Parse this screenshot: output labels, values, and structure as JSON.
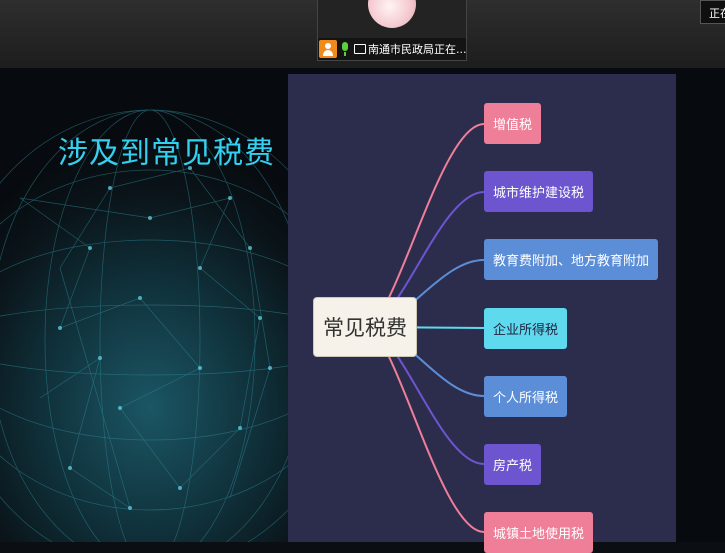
{
  "meeting": {
    "participant_name": "南通市民政局正在...",
    "status_text": "正在"
  },
  "slide": {
    "title": "涉及到常见税费",
    "mindmap": {
      "root": "常见税费",
      "branches": [
        {
          "label": "增值税",
          "color": "#ef7f99"
        },
        {
          "label": "城市维护建设税",
          "color": "#6c55cf"
        },
        {
          "label": "教育费附加、地方教育附加",
          "color": "#5c8ed8"
        },
        {
          "label": "企业所得税",
          "color": "#5fd9ee"
        },
        {
          "label": "个人所得税",
          "color": "#5c8ed8"
        },
        {
          "label": "房产税",
          "color": "#6c55cf"
        },
        {
          "label": "城镇土地使用税",
          "color": "#ef7f99"
        }
      ]
    }
  }
}
